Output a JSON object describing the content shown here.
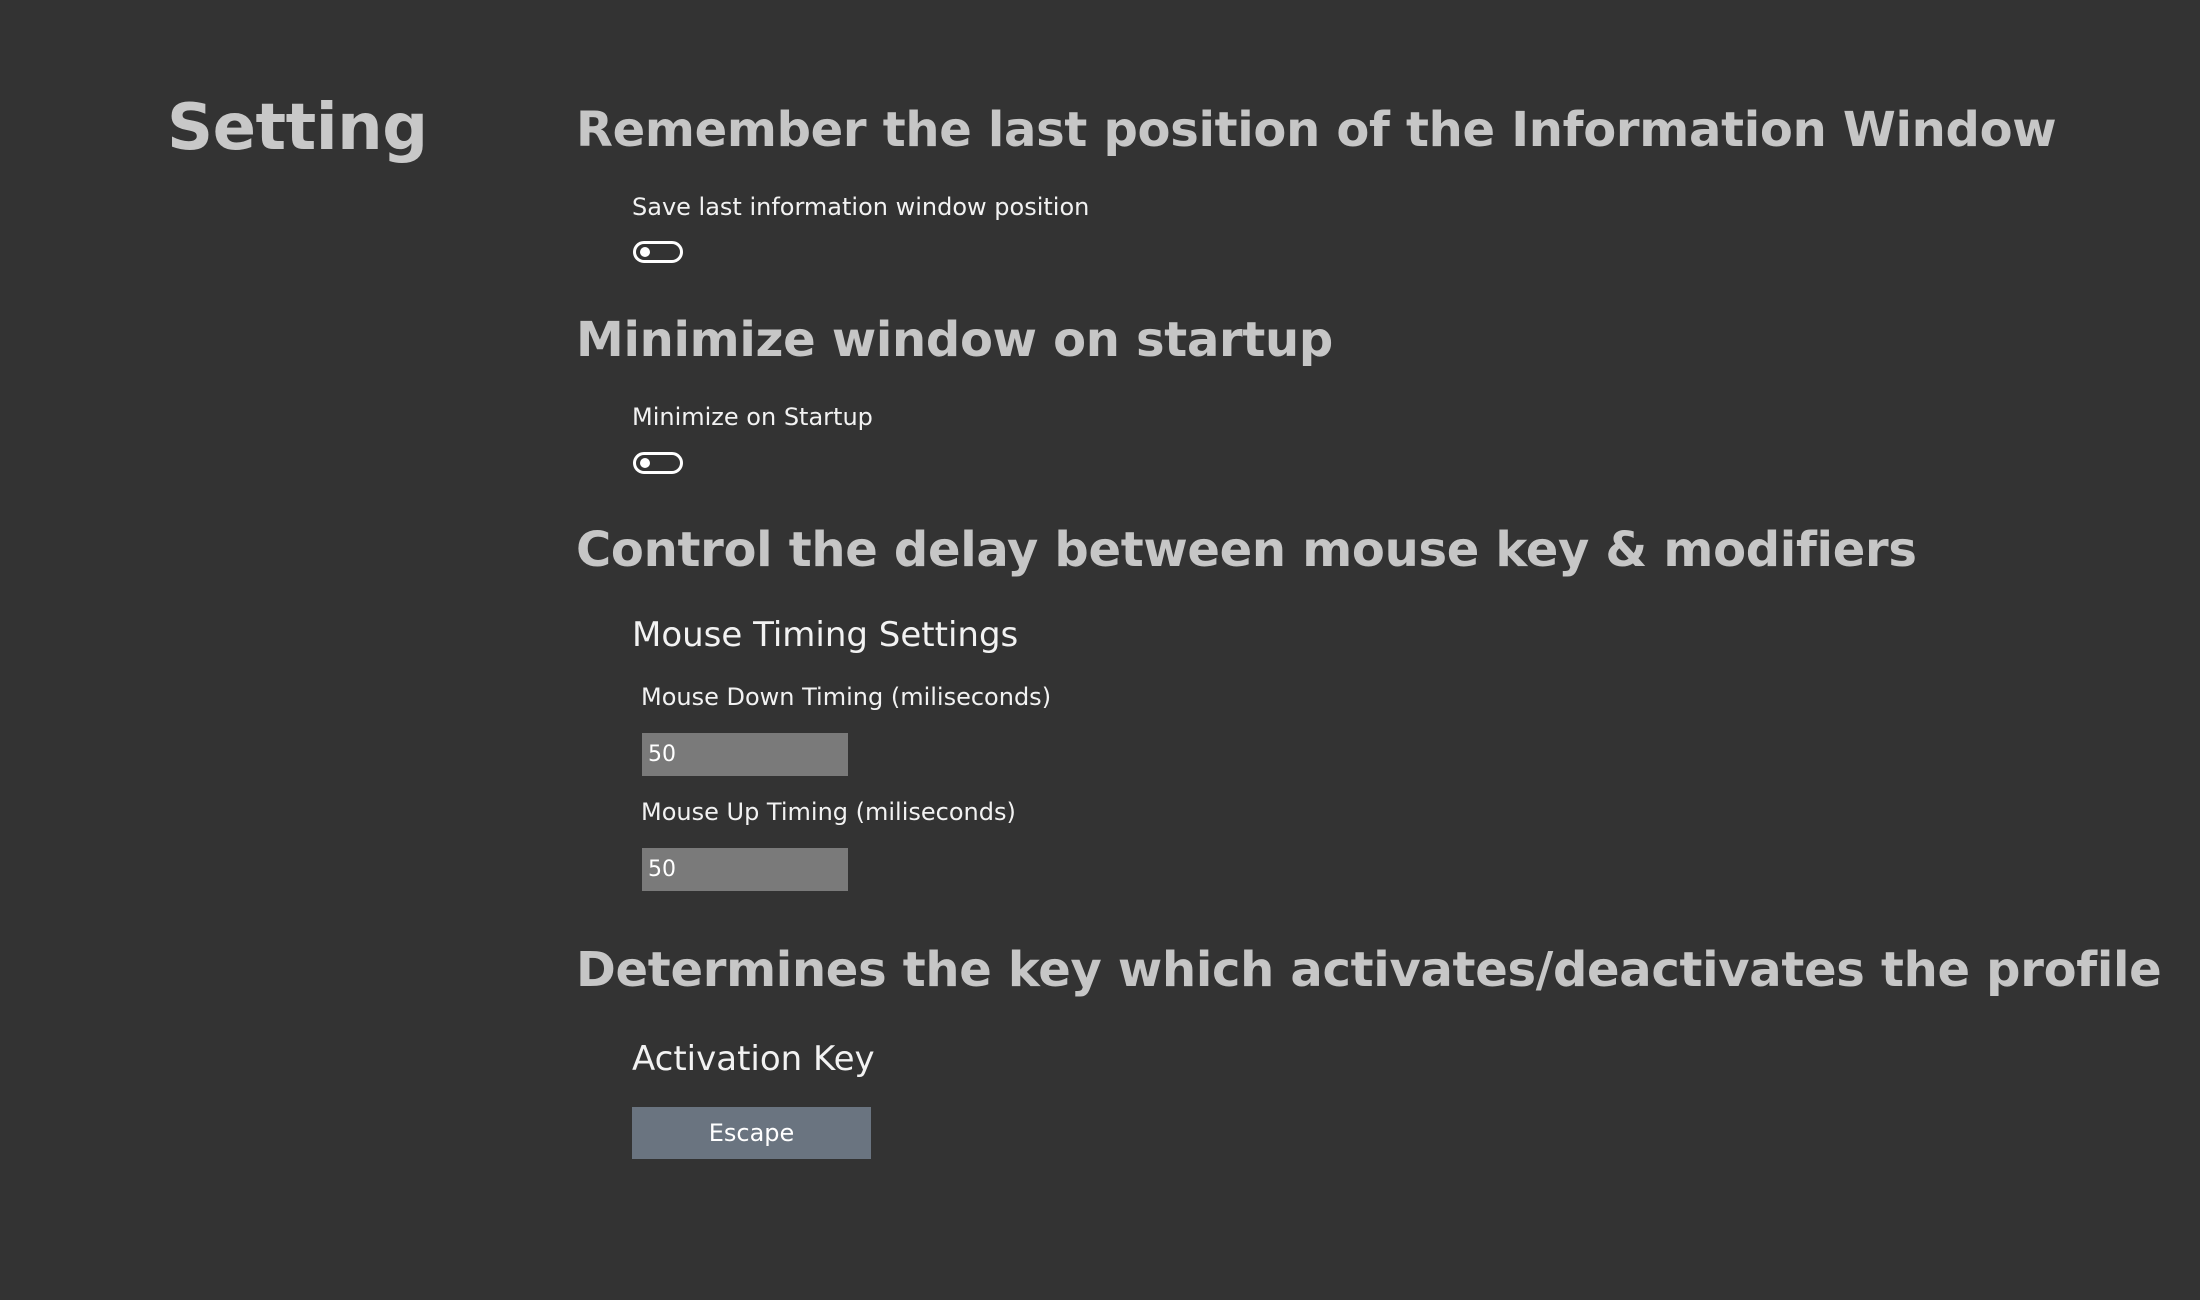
{
  "page": {
    "title": "Setting"
  },
  "sections": [
    {
      "heading": "Remember the last position of the Information Window",
      "label": "Save last information window position",
      "toggle_on": false
    },
    {
      "heading": "Minimize window on startup",
      "label": "Minimize on Startup",
      "toggle_on": false
    },
    {
      "heading": "Control the delay between mouse key & modifiers",
      "subheading": "Mouse Timing Settings",
      "fields": [
        {
          "label": "Mouse Down Timing (miliseconds)",
          "value": "50"
        },
        {
          "label": "Mouse Up Timing (miliseconds)",
          "value": "50"
        }
      ]
    },
    {
      "heading": "Determines the key which activates/deactivates the profile",
      "subheading": "Activation Key",
      "button_label": "Escape"
    }
  ],
  "colors": {
    "background": "#333333",
    "heading": "#c6c6c6",
    "text": "#f2f2f2",
    "input_bg": "#7a7a7a",
    "button_bg": "#6a7480"
  }
}
